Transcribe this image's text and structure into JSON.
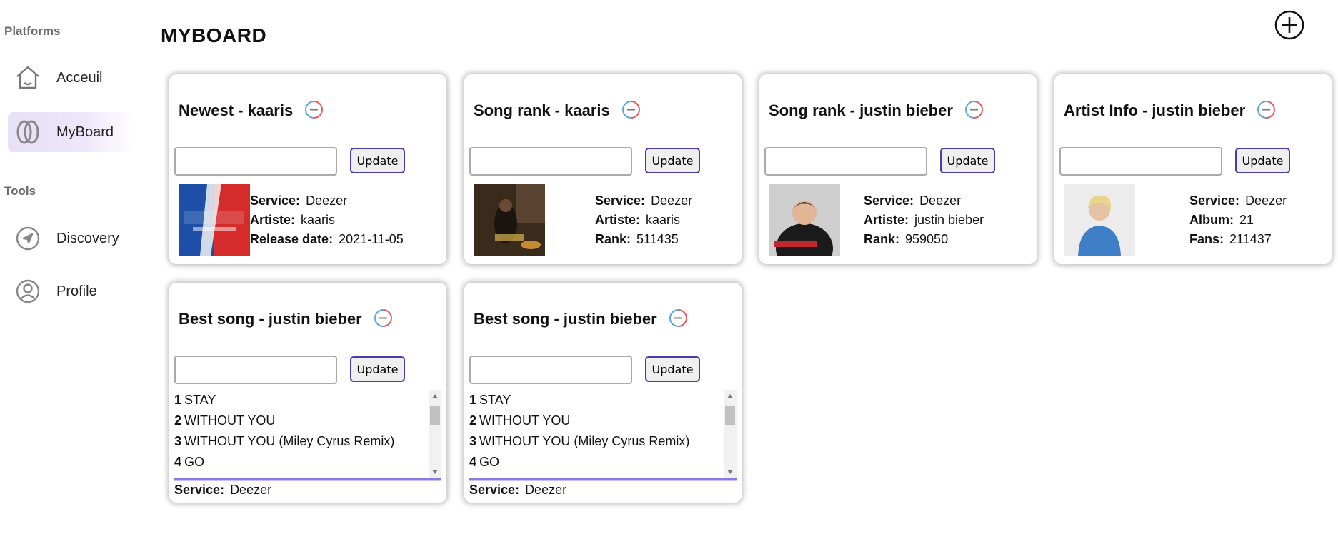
{
  "sidebar": {
    "platforms_title": "Platforms",
    "tools_title": "Tools",
    "items": [
      {
        "label": "Acceuil",
        "icon": "home-icon"
      },
      {
        "label": "MyBoard",
        "icon": "myboard-logo-icon",
        "active": true
      },
      {
        "label": "Discovery",
        "icon": "compass-icon"
      },
      {
        "label": "Profile",
        "icon": "user-icon"
      }
    ]
  },
  "header": {
    "title": "MYBOARD",
    "add_icon": "plus-circle-icon"
  },
  "widgets": {
    "update_label": "Update",
    "input_value": "",
    "accent_colors": [
      "#e35d5d",
      "#5aa7e6"
    ],
    "newest_kaaris": {
      "title": "Newest - kaaris",
      "fields": [
        {
          "key": "Service:",
          "value": "Deezer"
        },
        {
          "key": "Artiste:",
          "value": "kaaris"
        },
        {
          "key": "Release date:",
          "value": "2021-11-05"
        }
      ]
    },
    "song_rank_kaaris": {
      "title": "Song rank - kaaris",
      "fields": [
        {
          "key": "Service:",
          "value": "Deezer"
        },
        {
          "key": "Artiste:",
          "value": "kaaris"
        },
        {
          "key": "Rank:",
          "value": "511435"
        }
      ]
    },
    "song_rank_bieber": {
      "title": "Song rank - justin bieber",
      "fields": [
        {
          "key": "Service:",
          "value": "Deezer"
        },
        {
          "key": "Artiste:",
          "value": "justin bieber"
        },
        {
          "key": "Rank:",
          "value": "959050"
        }
      ]
    },
    "artist_info_bieber": {
      "title": "Artist Info - justin bieber",
      "fields": [
        {
          "key": "Service:",
          "value": "Deezer"
        },
        {
          "key": "Album:",
          "value": "21"
        },
        {
          "key": "Fans:",
          "value": "211437"
        }
      ]
    },
    "best_song_1": {
      "title": "Best song - justin bieber",
      "tracks": [
        {
          "num": "1",
          "name": "STAY"
        },
        {
          "num": "2",
          "name": "WITHOUT YOU"
        },
        {
          "num": "3",
          "name": "WITHOUT YOU (Miley Cyrus Remix)"
        },
        {
          "num": "4",
          "name": "GO"
        }
      ],
      "service_key": "Service:",
      "service_value": "Deezer"
    },
    "best_song_2": {
      "title": "Best song - justin bieber",
      "tracks": [
        {
          "num": "1",
          "name": "STAY"
        },
        {
          "num": "2",
          "name": "WITHOUT YOU"
        },
        {
          "num": "3",
          "name": "WITHOUT YOU (Miley Cyrus Remix)"
        },
        {
          "num": "4",
          "name": "GO"
        }
      ],
      "service_key": "Service:",
      "service_value": "Deezer"
    }
  }
}
